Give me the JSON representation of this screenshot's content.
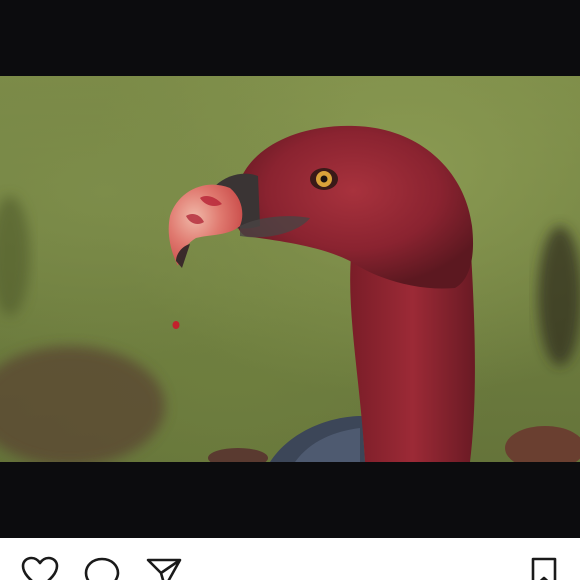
{
  "post": {
    "image_subject": "vulture-with-blood-stained-head",
    "colors": {
      "background": "#0c0c0e",
      "action_bar": "#ffffff",
      "icon_stroke": "#1a1a1a"
    }
  },
  "actions": {
    "like_icon": "heart-icon",
    "comment_icon": "comment-icon",
    "share_icon": "paper-plane-icon",
    "save_icon": "bookmark-icon"
  }
}
